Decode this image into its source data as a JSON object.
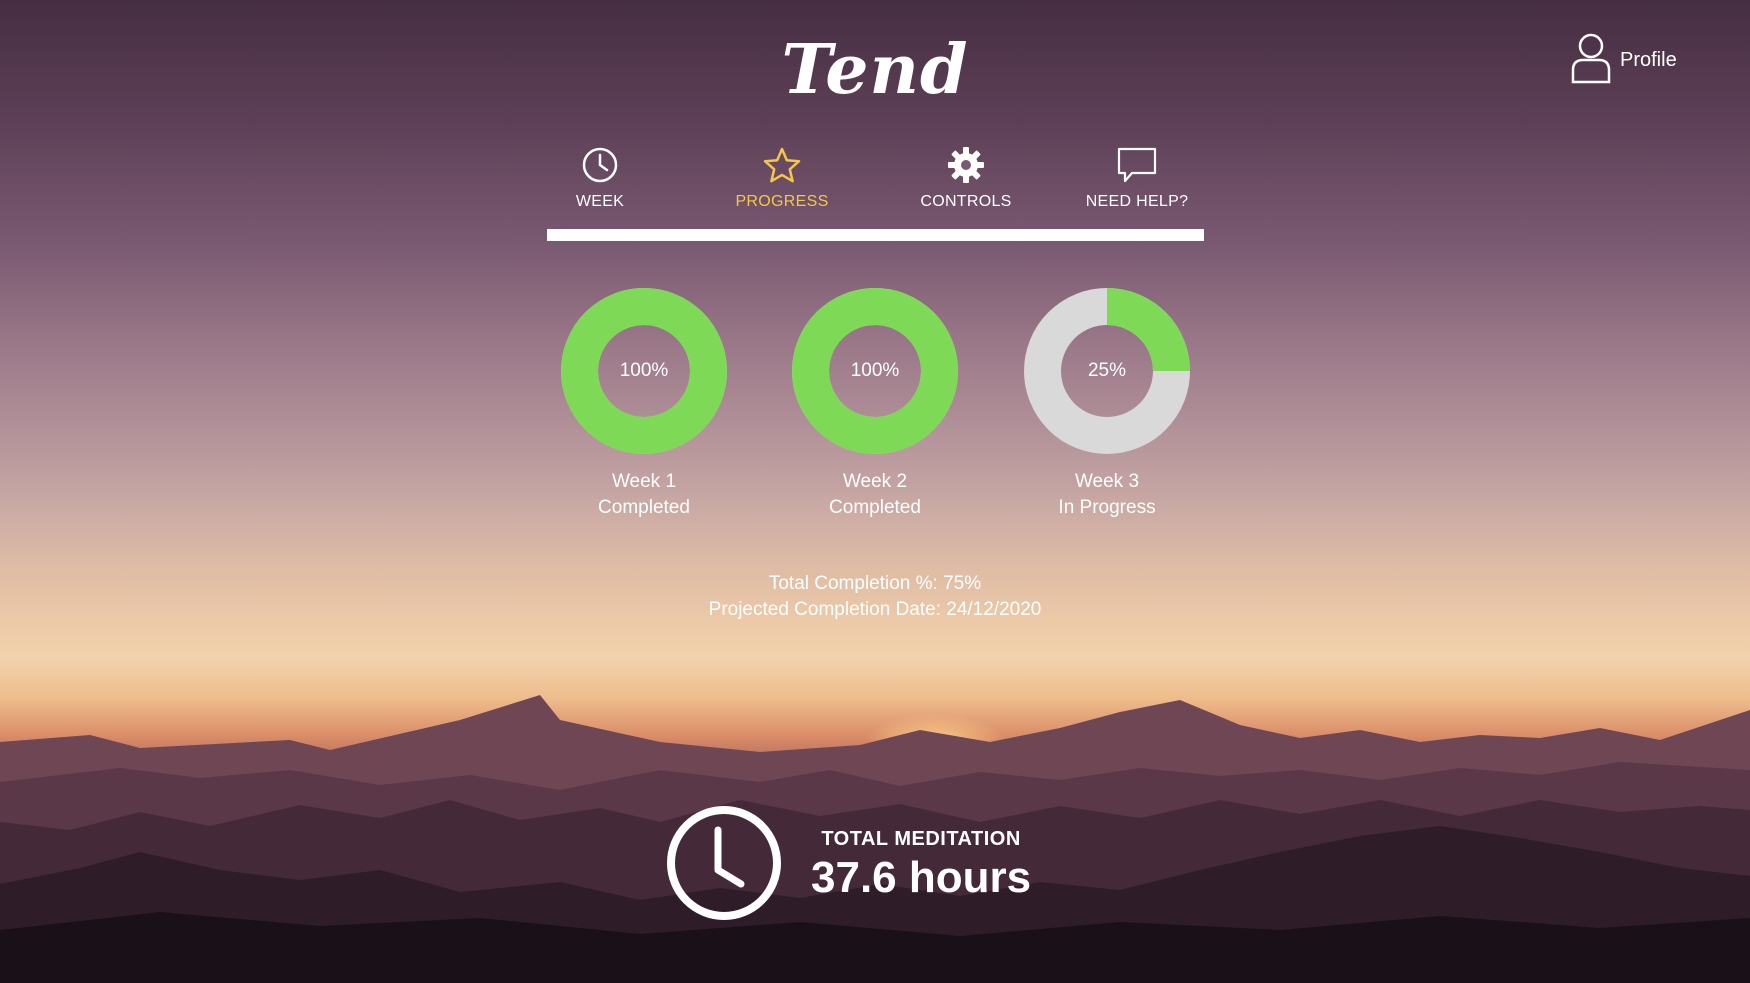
{
  "app": {
    "logo": "Tend"
  },
  "profile": {
    "label": "Profile",
    "icon": "user-icon"
  },
  "nav": {
    "active": "progress",
    "accent_color": "#f3c74a",
    "tabs": [
      {
        "id": "week",
        "label": "WEEK",
        "icon": "clock-icon"
      },
      {
        "id": "progress",
        "label": "PROGRESS",
        "icon": "star-icon"
      },
      {
        "id": "controls",
        "label": "CONTROLS",
        "icon": "gear-icon"
      },
      {
        "id": "help",
        "label": "NEED HELP?",
        "icon": "chat-bubble-icon"
      }
    ]
  },
  "progress": {
    "fill_color": "#7ed957",
    "track_color": "#d9d9d9",
    "weeks": [
      {
        "percent_label": "100%",
        "percent": 100,
        "title": "Week 1",
        "status": "Completed"
      },
      {
        "percent_label": "100%",
        "percent": 100,
        "title": "Week 2",
        "status": "Completed"
      },
      {
        "percent_label": "25%",
        "percent": 25,
        "title": "Week 3",
        "status": "In Progress"
      }
    ]
  },
  "summary": {
    "total_completion": "Total Completion %: 75%",
    "projected_date": "Projected Completion Date: 24/12/2020"
  },
  "meditation": {
    "label": "TOTAL MEDITATION",
    "value": "37.6 hours",
    "icon": "clock-icon"
  }
}
